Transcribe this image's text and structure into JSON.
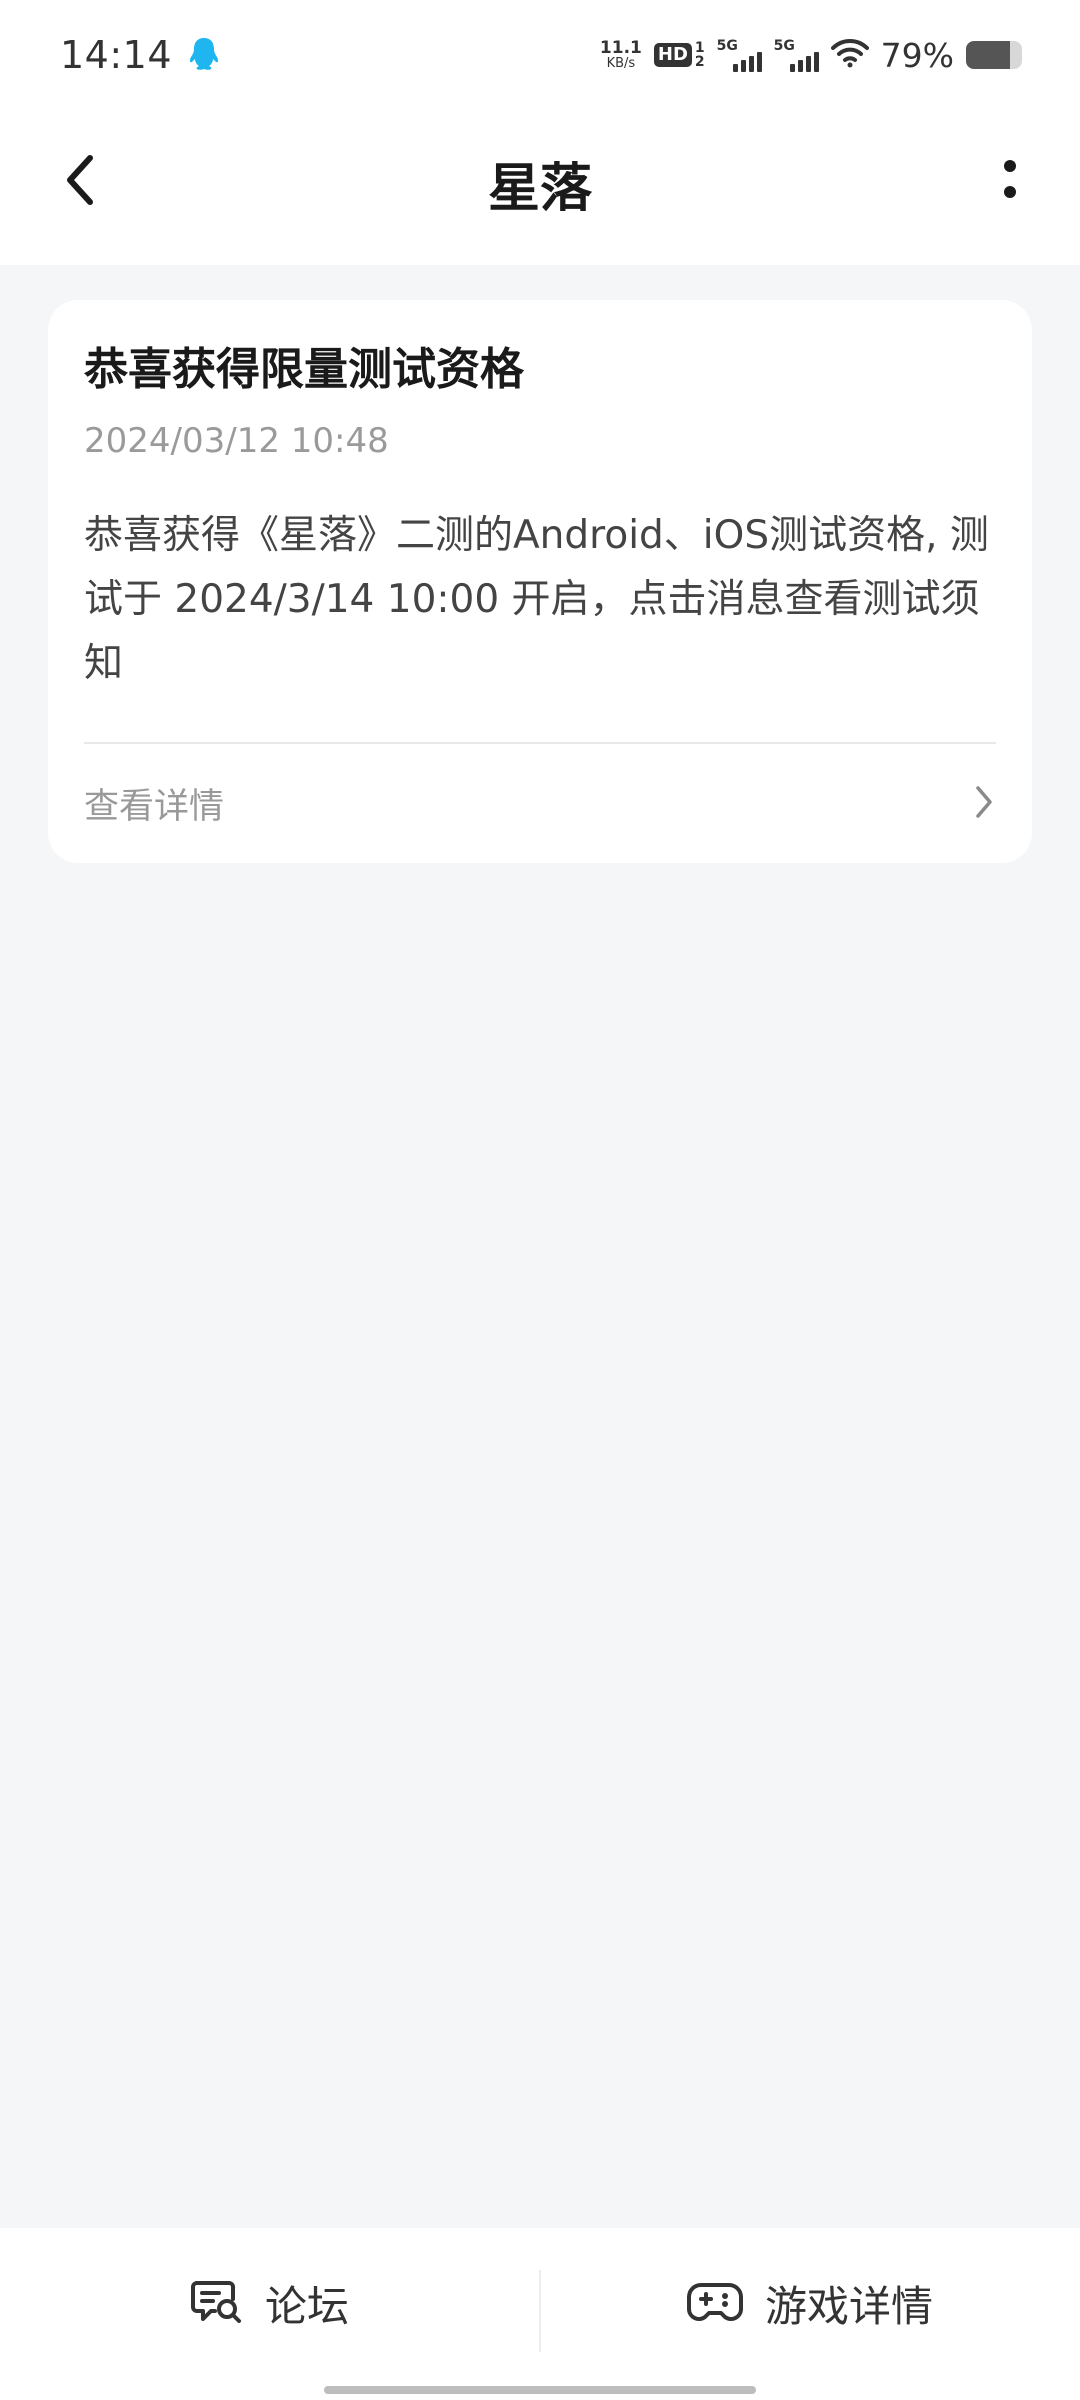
{
  "status_bar": {
    "time": "14:14",
    "net_speed_value": "11.1",
    "net_speed_unit": "KB/s",
    "hd_label": "HD",
    "hd_sim_top": "1",
    "hd_sim_bottom": "2",
    "sim1_label": "5G",
    "sim2_label": "5G",
    "battery_percent": "79%",
    "battery_level": 0.79,
    "notification_icon": "qq-icon"
  },
  "app_bar": {
    "title": "星落",
    "back_icon": "chevron-left-icon",
    "more_icon": "more-vertical-icon"
  },
  "message_card": {
    "title": "恭喜获得限量测试资格",
    "timestamp": "2024/03/12 10:48",
    "body": "恭喜获得《星落》二测的Android、iOS测试资格, 测试于 2024/3/14 10:00 开启，点击消息查看测试须知",
    "link_label": "查看详情",
    "link_icon": "chevron-right-icon"
  },
  "bottom_bar": {
    "items": [
      {
        "label": "论坛",
        "icon": "forum-search-icon"
      },
      {
        "label": "游戏详情",
        "icon": "gamepad-icon"
      }
    ]
  },
  "colors": {
    "background": "#f5f6f8",
    "card": "#ffffff",
    "accent_qq": "#1fb6f0",
    "muted_text": "#999999"
  }
}
